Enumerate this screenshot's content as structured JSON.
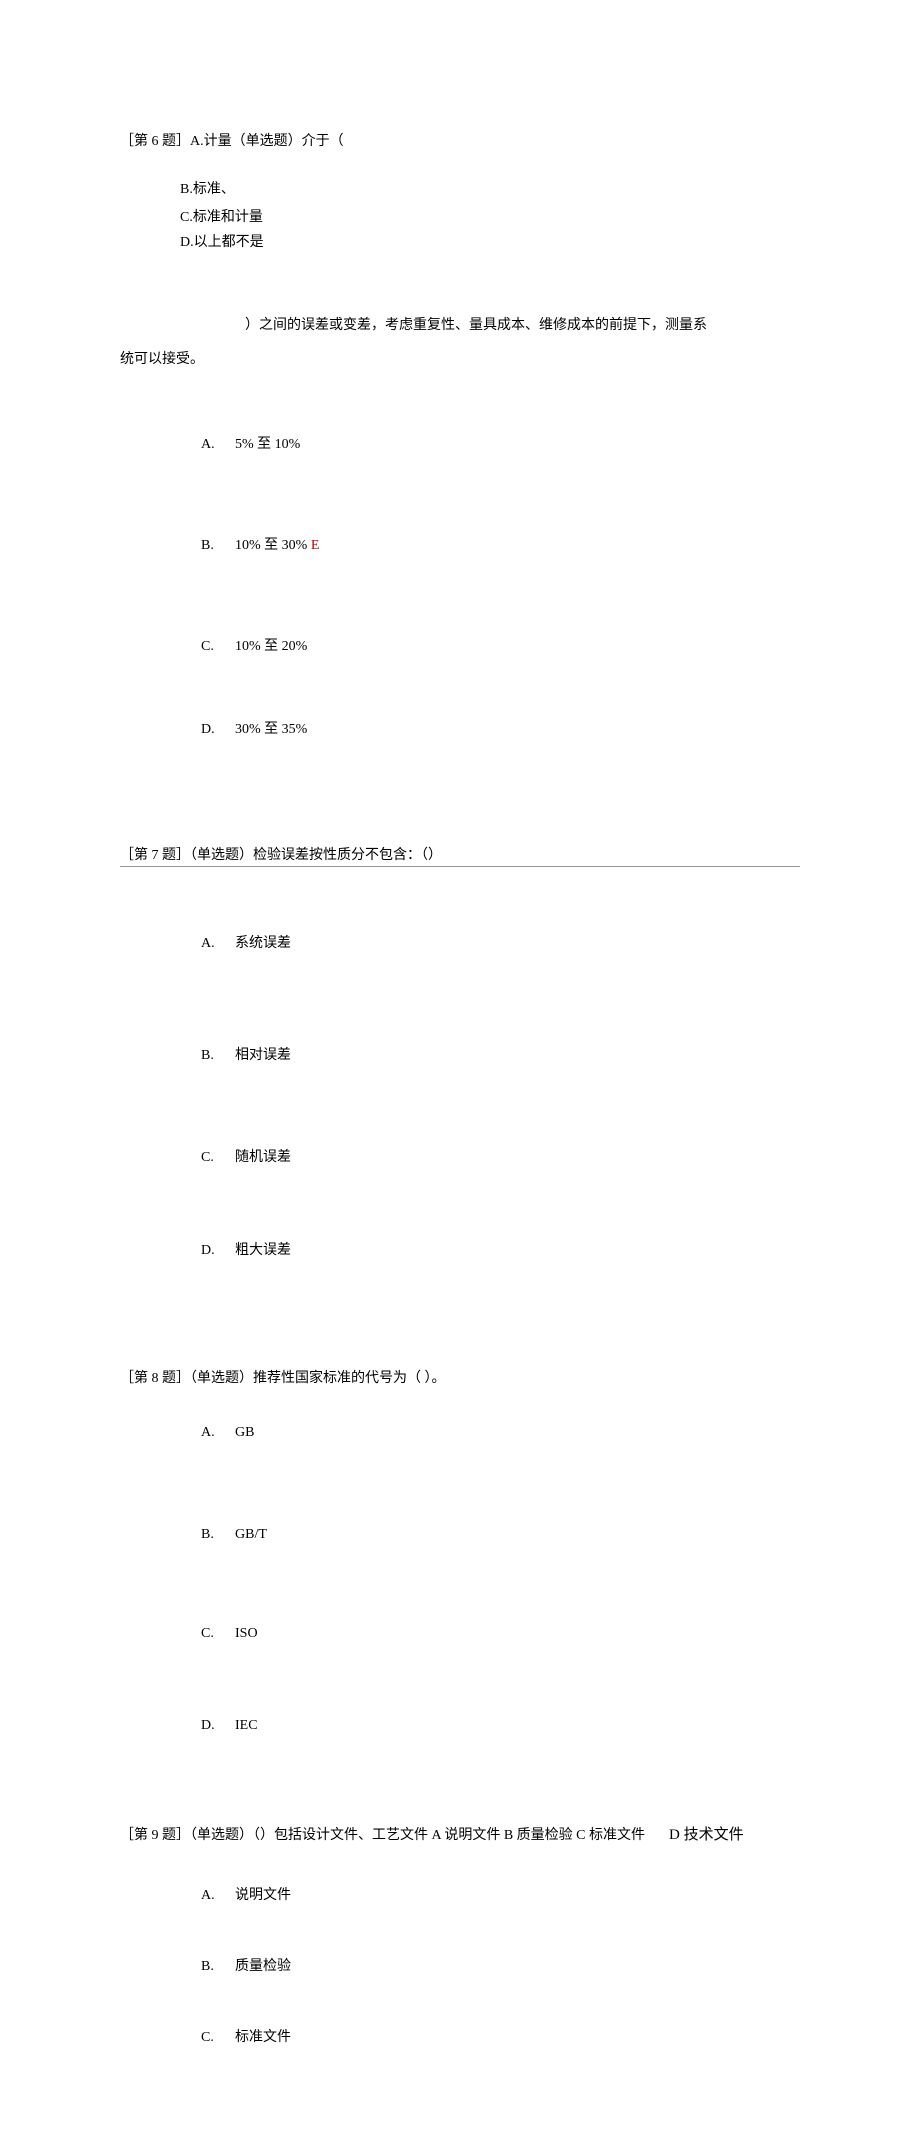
{
  "q6": {
    "header_prefix": "［第 6 题］",
    "header_after": "A.计量（单选题）介于（",
    "options": {
      "b": "B.标准、",
      "c": "C.标准和计量",
      "d": "D.以上都不是"
    },
    "mid": "）之间的误差或变差，考虑重复性、量具成本、维修成本的前提下，测量系",
    "tail": "统可以接受。",
    "opts2": {
      "a": {
        "label": "A.",
        "text": "5% 至 10%"
      },
      "b": {
        "label": "B.",
        "text": "10% 至 30%",
        "mark": "E"
      },
      "c": {
        "label": "C.",
        "text": "10% 至 20%"
      },
      "d": {
        "label": "D.",
        "text": "30% 至 35%"
      }
    }
  },
  "q7": {
    "header": "［第 7 题］（单选题）检验误差按性质分不包含：（）",
    "opts": {
      "a": {
        "label": "A.",
        "text": "系统误差"
      },
      "b": {
        "label": "B.",
        "text": "相对误差"
      },
      "c": {
        "label": "C.",
        "text": "随机误差"
      },
      "d": {
        "label": "D.",
        "text": "粗大误差"
      }
    }
  },
  "q8": {
    "header": "［第 8 题］（单选题）推荐性国家标准的代号为（     ）。",
    "opts": {
      "a": {
        "label": "A.",
        "text": "GB"
      },
      "b": {
        "label": "B.",
        "text": "GB/T"
      },
      "c": {
        "label": "C.",
        "text": "ISO"
      },
      "d": {
        "label": "D.",
        "text": "IEC"
      }
    }
  },
  "q9": {
    "header": "［第 9 题］（单选题）（）包括设计文件、工艺文件  A 说明文件 B 质量检验 C 标准文件",
    "annot": "D 技术文件",
    "opts": {
      "a": {
        "label": "A.",
        "text": "说明文件"
      },
      "b": {
        "label": "B.",
        "text": "质量检验"
      },
      "c": {
        "label": "C.",
        "text": "标准文件"
      }
    }
  }
}
